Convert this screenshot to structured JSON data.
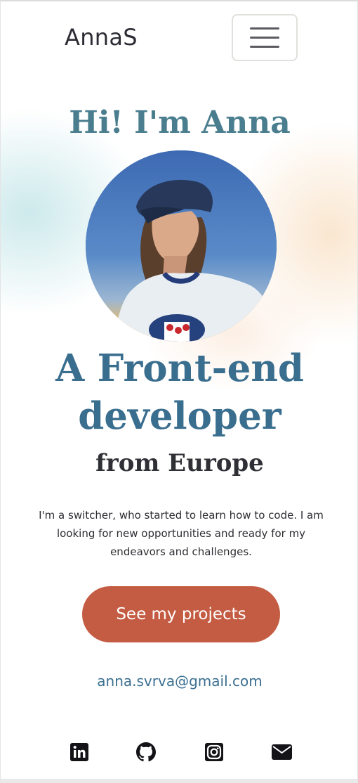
{
  "nav": {
    "brand": "AnnaS",
    "menu_icon": "hamburger-menu-icon"
  },
  "hero": {
    "greeting": "Hi! I'm Anna",
    "photo_icon": "profile-photo",
    "headline_line1": "A Front-end",
    "headline_line2": "developer",
    "subheadline": "from Europe",
    "intro": "I'm a switcher, who started to learn how to code. I am looking for new opportunities and ready for my endeavors and challenges.",
    "cta_label": "See my projects",
    "email": "anna.svrva@gmail.com"
  },
  "social": [
    {
      "icon": "linkedin-icon"
    },
    {
      "icon": "github-icon"
    },
    {
      "icon": "instagram-icon"
    },
    {
      "icon": "envelope-icon"
    }
  ],
  "colors": {
    "accent_teal": "#4a7e8e",
    "headline_blue": "#3a6e8f",
    "cta_orange": "#c45c43",
    "text_dark": "#2d2d33"
  }
}
